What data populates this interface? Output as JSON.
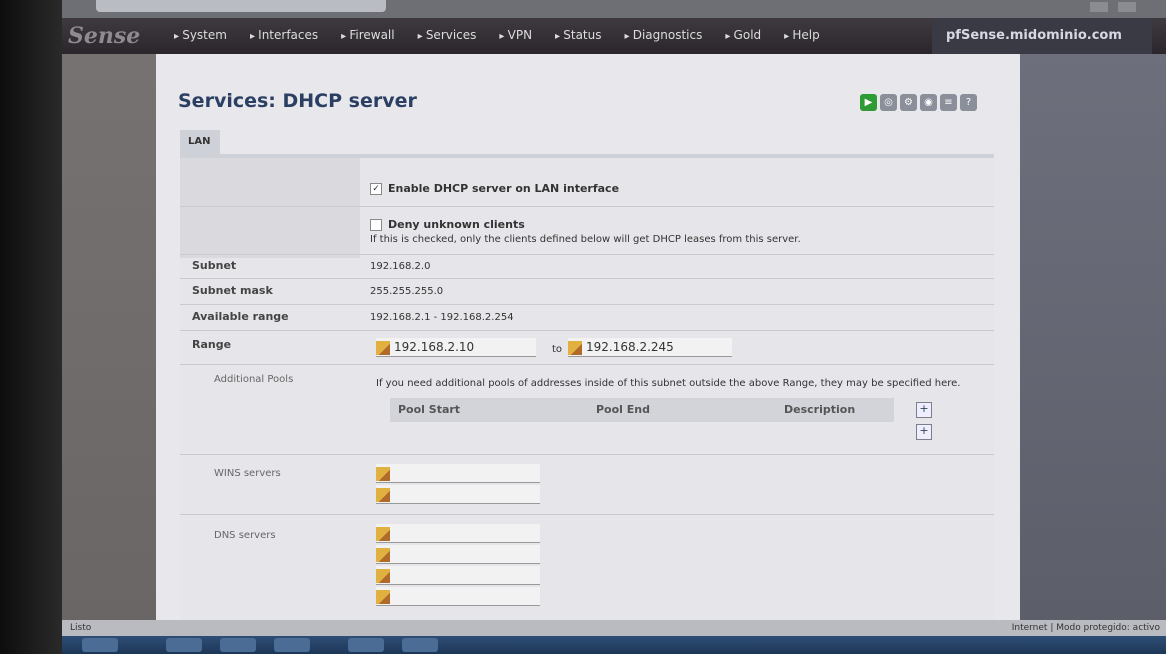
{
  "navbar": {
    "logo": "Sense",
    "menu": [
      "System",
      "Interfaces",
      "Firewall",
      "Services",
      "VPN",
      "Status",
      "Diagnostics",
      "Gold",
      "Help"
    ],
    "host": "pfSense.midominio.com"
  },
  "page": {
    "title": "Services: DHCP server",
    "tab": "LAN"
  },
  "form": {
    "enable_label": "Enable DHCP server on LAN interface",
    "enable_checked": true,
    "deny_label": "Deny unknown clients",
    "deny_help": "If this is checked, only the clients defined below will get DHCP leases from this server.",
    "subnet_label": "Subnet",
    "subnet_value": "192.168.2.0",
    "mask_label": "Subnet mask",
    "mask_value": "255.255.255.0",
    "avail_label": "Available range",
    "avail_value": "192.168.2.1 - 192.168.2.254",
    "range_label": "Range",
    "range_from": "192.168.2.10",
    "range_to_word": "to",
    "range_to": "192.168.2.245",
    "pools_label": "Additional Pools",
    "pools_help": "If you need additional pools of addresses inside of this subnet outside the above Range, they may be specified here.",
    "pool_cols": [
      "Pool Start",
      "Pool End",
      "Description"
    ],
    "wins_label": "WINS servers",
    "dns_label": "DNS servers"
  },
  "status": {
    "left": "Listo",
    "right": "Internet | Modo protegido: activo"
  }
}
